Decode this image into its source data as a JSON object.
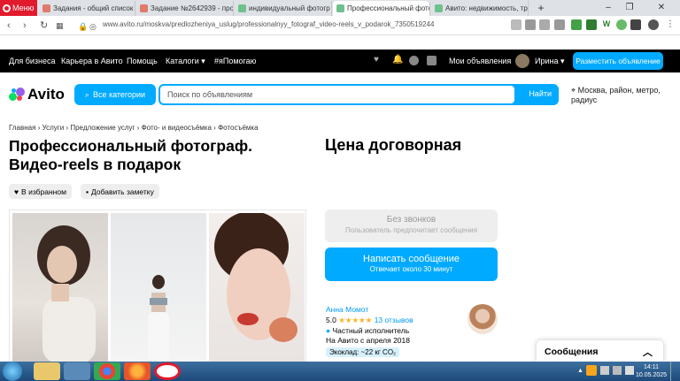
{
  "browser": {
    "menu_label": "Меню",
    "tabs": [
      {
        "label": "Задания - общий список"
      },
      {
        "label": "Задание №2642939 - про"
      },
      {
        "label": "индивидуальный фотогр"
      },
      {
        "label": "Профессиональный фото",
        "active": true
      },
      {
        "label": "Авито: недвижимость, тр"
      }
    ],
    "new_tab": "+",
    "url": "www.avito.ru/moskva/predlozheniya_uslug/professionalnyy_fotograf_video-reels_v_podarok_7350519244"
  },
  "topnav": {
    "links": [
      "Для бизнеса",
      "Карьера в Авито",
      "Помощь",
      "Каталоги ▾",
      "#яПомогаю"
    ],
    "my_ads": "Мои объявления",
    "user_name": "Ирина ▾",
    "post_button": "Разместить объявление"
  },
  "header": {
    "logo_text": "Avito",
    "categories_button": "Все категории",
    "search_placeholder": "Поиск по объявлениям",
    "search_button": "Найти",
    "location": "Москва, район, метро, радиус"
  },
  "listing": {
    "breadcrumbs": [
      "Главная",
      "Услуги",
      "Предложение услуг",
      "Фото- и видеосъёмка",
      "Фотосъёмка"
    ],
    "breadcrumb_sep": "›",
    "title": "Профессиональный фотограф. Видео-reels в подарок",
    "favorite_button": "В избранном",
    "note_button": "Добавить заметку",
    "price": "Цена договорная",
    "no_calls_title": "Без звонков",
    "no_calls_sub": "Пользователь предпочитает сообщения",
    "message_button": "Написать сообщение",
    "message_sub": "Отвечает около 30 минут"
  },
  "seller": {
    "name": "Анна Момот",
    "rating": "5.0",
    "stars": "★★★★★",
    "reviews": "13 отзывов",
    "type": "Частный исполнитель",
    "since": "На Авито с апреля 2018",
    "eco": "Экоклад: ~22 кг CO₂"
  },
  "messages_widget": {
    "title": "Сообщения"
  },
  "taskbar": {
    "time": "14:11",
    "date": "10.05.2025"
  },
  "colors": {
    "accent": "#00aaff",
    "opera_red": "#e21a2d",
    "black_nav": "#000000",
    "star": "#ffb021"
  }
}
